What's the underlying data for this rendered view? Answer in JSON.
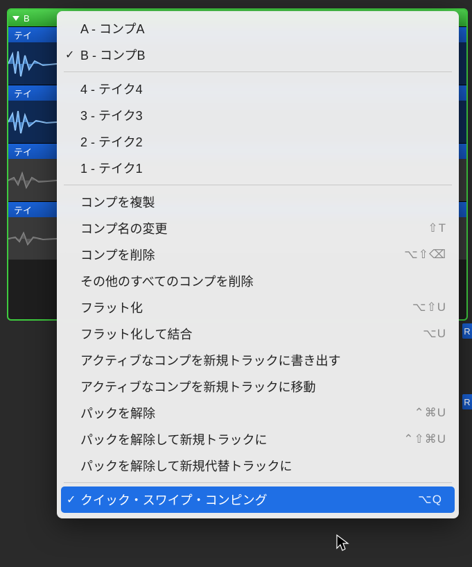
{
  "comp_header": "B",
  "takes": [
    "テイ",
    "テイ",
    "テイ",
    "テイ"
  ],
  "menu": {
    "section_comps": [
      {
        "label": "A - コンプA",
        "checked": false
      },
      {
        "label": "B - コンプB",
        "checked": true
      }
    ],
    "section_takes": [
      {
        "label": "4 - テイク4"
      },
      {
        "label": "3 - テイク3"
      },
      {
        "label": "2 - テイク2"
      },
      {
        "label": "1 - テイク1"
      }
    ],
    "section_actions": [
      {
        "label": "コンプを複製",
        "shortcut": ""
      },
      {
        "label": "コンプ名の変更",
        "shortcut": "⇧T"
      },
      {
        "label": "コンプを削除",
        "shortcut": "⌥⇧⌫"
      },
      {
        "label": "その他のすべてのコンプを削除",
        "shortcut": ""
      },
      {
        "label": "フラット化",
        "shortcut": "⌥⇧U"
      },
      {
        "label": "フラット化して結合",
        "shortcut": "⌥U"
      },
      {
        "label": "アクティブなコンプを新規トラックに書き出す",
        "shortcut": ""
      },
      {
        "label": "アクティブなコンプを新規トラックに移動",
        "shortcut": ""
      },
      {
        "label": "パックを解除",
        "shortcut": "⌃⌘U"
      },
      {
        "label": "パックを解除して新規トラックに",
        "shortcut": "⌃⇧⌘U"
      },
      {
        "label": "パックを解除して新規代替トラックに",
        "shortcut": ""
      }
    ],
    "section_footer": [
      {
        "label": "クイック・スワイプ・コンピング",
        "shortcut": "⌥Q",
        "checked": true,
        "highlight": true
      }
    ]
  },
  "stub_label": "R"
}
